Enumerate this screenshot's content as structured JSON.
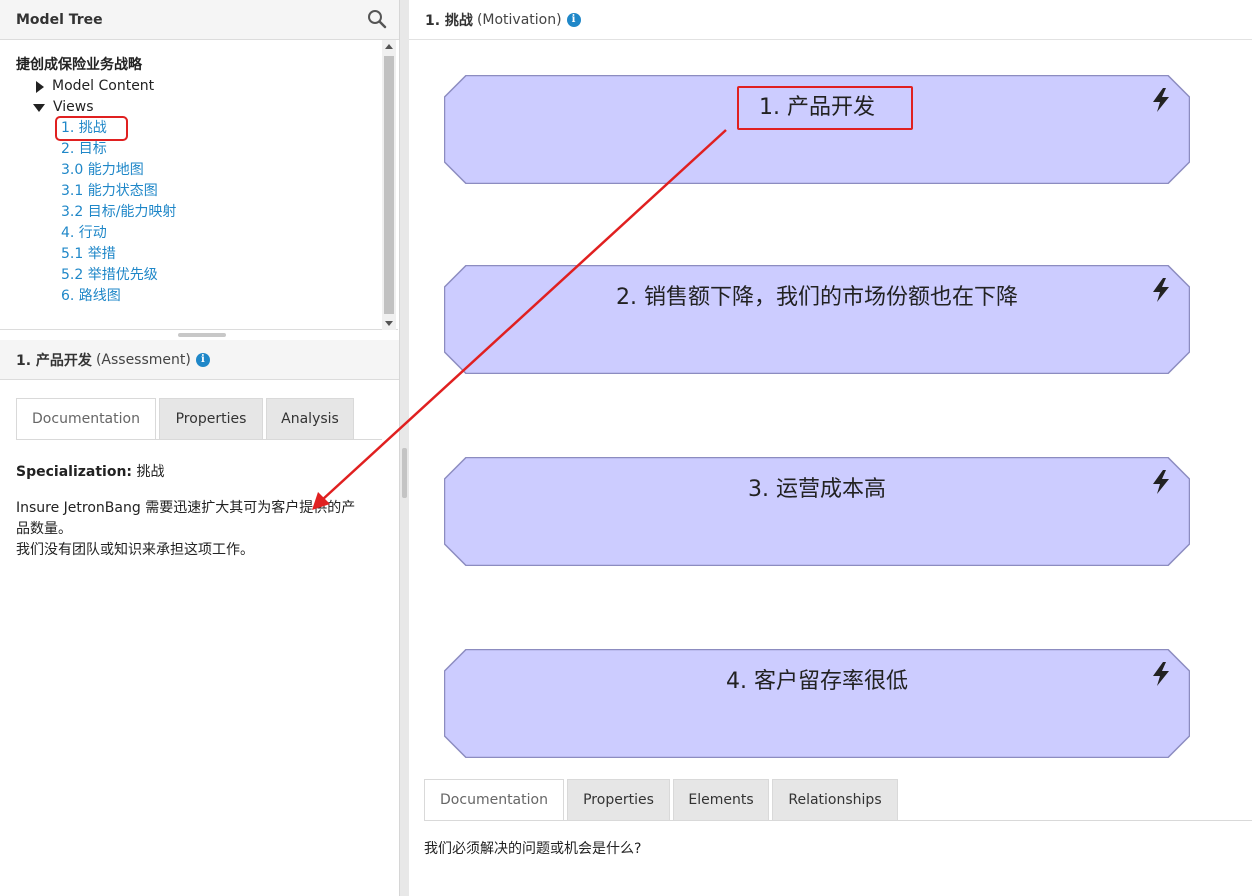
{
  "model_tree": {
    "title": "Model Tree",
    "root": "捷创成保险业务战略",
    "model_content": "Model Content",
    "views_label": "Views",
    "views": [
      "1. 挑战",
      "2. 目标",
      "3.0 能力地图",
      "3.1 能力状态图",
      "3.2 目标/能力映射",
      "4. 行动",
      "5.1 举措",
      "5.2 举措优先级",
      "6. 路线图"
    ],
    "selected_index": 0
  },
  "element_panel": {
    "title": "1. 产品开发",
    "type": "(Assessment)",
    "tabs": [
      "Documentation",
      "Properties",
      "Analysis"
    ],
    "active_tab": 0,
    "specialization_label": "Specialization:",
    "specialization_value": "挑战",
    "doc_line1": "Insure JetronBang 需要迅速扩大其可为客户提供的产",
    "doc_line2": "品数量。",
    "doc_line3": "我们没有团队或知识来承担这项工作。"
  },
  "view": {
    "title": "1. 挑战",
    "type": "(Motivation)",
    "elements": [
      {
        "label": "1. 产品开发"
      },
      {
        "label": "2. 销售额下降，我们的市场份额也在下降"
      },
      {
        "label": "3. 运营成本高"
      },
      {
        "label": "4. 客户留存率很低"
      }
    ],
    "tabs": [
      "Documentation",
      "Properties",
      "Elements",
      "Relationships"
    ],
    "active_tab": 0,
    "documentation": "我们必须解决的问题或机会是什么?"
  },
  "colors": {
    "accent": "#1f87c8",
    "assessment_fill": "#ccccff",
    "assessment_stroke": "#8c8cc0",
    "annotation": "#e02020"
  },
  "icons": {
    "search": "search-icon",
    "info": "info-icon",
    "assessment": "lightning-bolt-icon"
  }
}
